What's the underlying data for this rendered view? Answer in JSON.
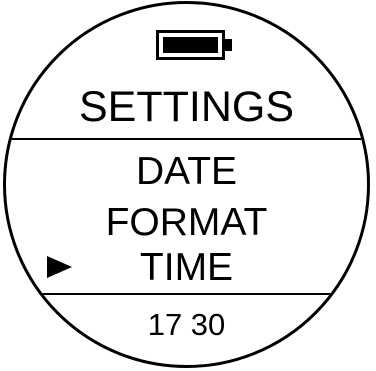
{
  "header": {
    "battery_icon": "battery-icon",
    "battery_level": 1.0,
    "title": "SETTINGS"
  },
  "menu": {
    "items": [
      {
        "label": "DATE"
      },
      {
        "label": "FORMAT"
      },
      {
        "label": "TIME",
        "selected": true
      }
    ],
    "pointer_icon": "triangle-right-icon"
  },
  "footer": {
    "value": "17 30"
  },
  "colors": {
    "foreground": "#000000",
    "background": "#ffffff"
  }
}
